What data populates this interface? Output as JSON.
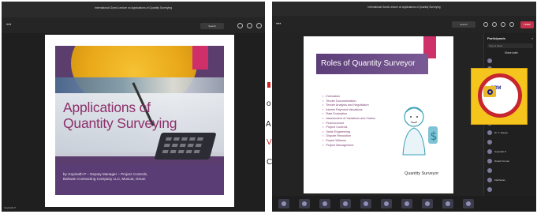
{
  "left": {
    "title": "International Guest Lecture on Applications of Quantity Surveying",
    "search_label": "Search",
    "slide": {
      "title_line1": "Applications of",
      "title_line2": "Quantity Surveying",
      "byline_line1": "by Gopinath P – Deputy Manager – Project Controls,",
      "byline_line2": "Bahwan Contracting Company LLC, Muscat, Oman"
    },
    "presenter": "Gopinath P"
  },
  "fragments": [
    "o",
    "A",
    "V",
    "C"
  ],
  "right": {
    "title": "International Guest Lecture on Applications of Quantity Surveying",
    "search_label": "Search",
    "leave_label": "Leave",
    "slide": {
      "title": "Roles of Quantity Surveyor",
      "roles": [
        "Estimation",
        "Tender Documentation",
        "Tender Analysis and Negotiation",
        "Interim Payment Valuations",
        "Rate Evaluation",
        "Assessment of Variations and Claims",
        "Final Account",
        "Project Controls",
        "Value Engineering",
        "Dispute Resolution",
        "Expert Witness",
        "Project Management"
      ],
      "caption": "Quantity Surveyor"
    },
    "participants": {
      "title": "Participants",
      "close": "×",
      "search_placeholder": "Type a name",
      "share_invite": "Share invite",
      "names": [
        "",
        "",
        "",
        "",
        "",
        "",
        "Dr. T. Ranga",
        "",
        "Gopinath P",
        "Dinesh Kumar",
        "",
        "Madhavan",
        "",
        "",
        "Sri Vigneshwaran",
        ""
      ]
    },
    "logo_text": "SRM"
  },
  "bottom_mark": "t",
  "colors": {
    "accent_pink": "#d0306a",
    "slide_purple": "#5c3e6e",
    "title_magenta": "#8c2f6a",
    "leave_red": "#c4314b",
    "logo_yellow": "#f5c51d"
  }
}
